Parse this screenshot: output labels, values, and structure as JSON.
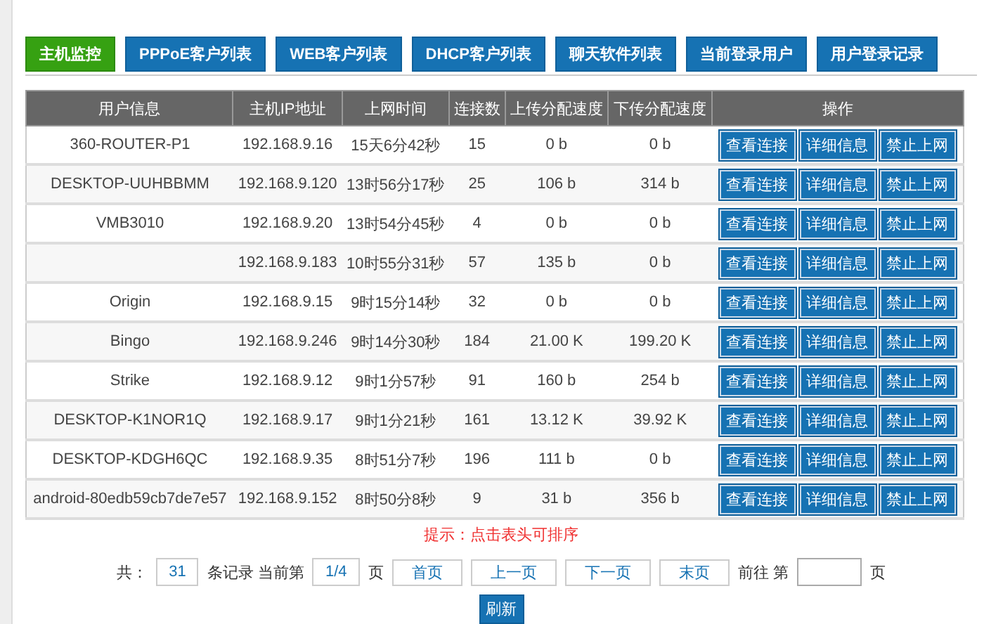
{
  "tabs": [
    {
      "label": "主机监控",
      "selected": true
    },
    {
      "label": "PPPoE客户列表",
      "selected": false
    },
    {
      "label": "WEB客户列表",
      "selected": false
    },
    {
      "label": "DHCP客户列表",
      "selected": false
    },
    {
      "label": "聊天软件列表",
      "selected": false
    },
    {
      "label": "当前登录用户",
      "selected": false
    },
    {
      "label": "用户登录记录",
      "selected": false
    }
  ],
  "table": {
    "columns": [
      "用户信息",
      "主机IP地址",
      "上网时间",
      "连接数",
      "上传分配速度",
      "下传分配速度",
      "操作"
    ],
    "rows": [
      {
        "user": "360-ROUTER-P1",
        "ip": "192.168.9.16",
        "time": "15天6分42秒",
        "conns": "15",
        "up": "0 b",
        "down": "0 b",
        "actions": [
          "查看连接",
          "详细信息",
          "禁止上网"
        ]
      },
      {
        "user": "DESKTOP-UUHBBMM",
        "ip": "192.168.9.120",
        "time": "13时56分17秒",
        "conns": "25",
        "up": "106 b",
        "down": "314 b",
        "actions": [
          "查看连接",
          "详细信息",
          "禁止上网"
        ]
      },
      {
        "user": "VMB3010",
        "ip": "192.168.9.20",
        "time": "13时54分45秒",
        "conns": "4",
        "up": "0 b",
        "down": "0 b",
        "actions": [
          "查看连接",
          "详细信息",
          "禁止上网"
        ]
      },
      {
        "user": "",
        "ip": "192.168.9.183",
        "time": "10时55分31秒",
        "conns": "57",
        "up": "135 b",
        "down": "0 b",
        "actions": [
          "查看连接",
          "详细信息",
          "禁止上网"
        ]
      },
      {
        "user": "Origin",
        "ip": "192.168.9.15",
        "time": "9时15分14秒",
        "conns": "32",
        "up": "0 b",
        "down": "0 b",
        "actions": [
          "查看连接",
          "详细信息",
          "禁止上网"
        ]
      },
      {
        "user": "Bingo",
        "ip": "192.168.9.246",
        "time": "9时14分30秒",
        "conns": "184",
        "up": "21.00 K",
        "down": "199.20 K",
        "actions": [
          "查看连接",
          "详细信息",
          "禁止上网"
        ]
      },
      {
        "user": "Strike",
        "ip": "192.168.9.12",
        "time": "9时1分57秒",
        "conns": "91",
        "up": "160 b",
        "down": "254 b",
        "actions": [
          "查看连接",
          "详细信息",
          "禁止上网"
        ]
      },
      {
        "user": "DESKTOP-K1NOR1Q",
        "ip": "192.168.9.17",
        "time": "9时1分21秒",
        "conns": "161",
        "up": "13.12 K",
        "down": "39.92 K",
        "actions": [
          "查看连接",
          "详细信息",
          "禁止上网"
        ]
      },
      {
        "user": "DESKTOP-KDGH6QC",
        "ip": "192.168.9.35",
        "time": "8时51分7秒",
        "conns": "196",
        "up": "111 b",
        "down": "0 b",
        "actions": [
          "查看连接",
          "详细信息",
          "禁止上网"
        ]
      },
      {
        "user": "android-80edb59cb7de7e57",
        "ip": "192.168.9.152",
        "time": "8时50分8秒",
        "conns": "9",
        "up": "31 b",
        "down": "356 b",
        "actions": [
          "查看连接",
          "详细信息",
          "禁止上网"
        ]
      }
    ]
  },
  "hint": "提示：点击表头可排序",
  "pager": {
    "total_label": "共：",
    "total": "31",
    "records_label": "条记录 当前第",
    "page": "1/4",
    "page_label": "页",
    "buttons": [
      "首页",
      "上一页",
      "下一页",
      "末页"
    ],
    "goto_label": "前往 第",
    "goto_suffix": "页"
  },
  "refresh": "刷新"
}
